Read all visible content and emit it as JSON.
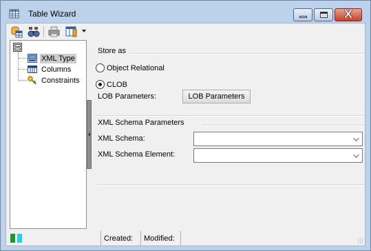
{
  "window": {
    "title": "Table Wizard",
    "icon": "table-grid-icon",
    "controls": {
      "minimize": "minimize-icon",
      "maximize": "maximize-icon",
      "close": "close-icon"
    }
  },
  "toolbar": {
    "buttons": [
      {
        "name": "database-table-icon"
      },
      {
        "name": "binoculars-icon"
      },
      {
        "name": "printer-icon"
      },
      {
        "name": "column-layout-icon",
        "has_dropdown": true
      }
    ]
  },
  "tree": {
    "root_icon": "tree-root-icon",
    "items": [
      {
        "label": "XML Type",
        "icon": "xml-type-icon",
        "selected": true
      },
      {
        "label": "Columns",
        "icon": "columns-icon",
        "selected": false
      },
      {
        "label": "Constraints",
        "icon": "key-icon",
        "selected": false
      }
    ]
  },
  "store_as": {
    "title": "Store as",
    "options": [
      {
        "label": "Object Relational",
        "checked": false
      },
      {
        "label": "CLOB",
        "checked": true
      }
    ]
  },
  "lob": {
    "label": "LOB Parameters:",
    "button_label": "LOB Parameters"
  },
  "xml_schema": {
    "title": "XML Schema Parameters",
    "schema_label": "XML Schema:",
    "schema_value": "",
    "element_label": "XML Schema Element:",
    "element_value": ""
  },
  "status": {
    "created_label": "Created:",
    "modified_label": "Modified:",
    "progress_colors": [
      "#1a9a2e",
      "#22d4e8"
    ]
  },
  "colors": {
    "titlebar": "#bcd1ea",
    "close_button": "#c5432a",
    "client": "#f0f0f0"
  }
}
